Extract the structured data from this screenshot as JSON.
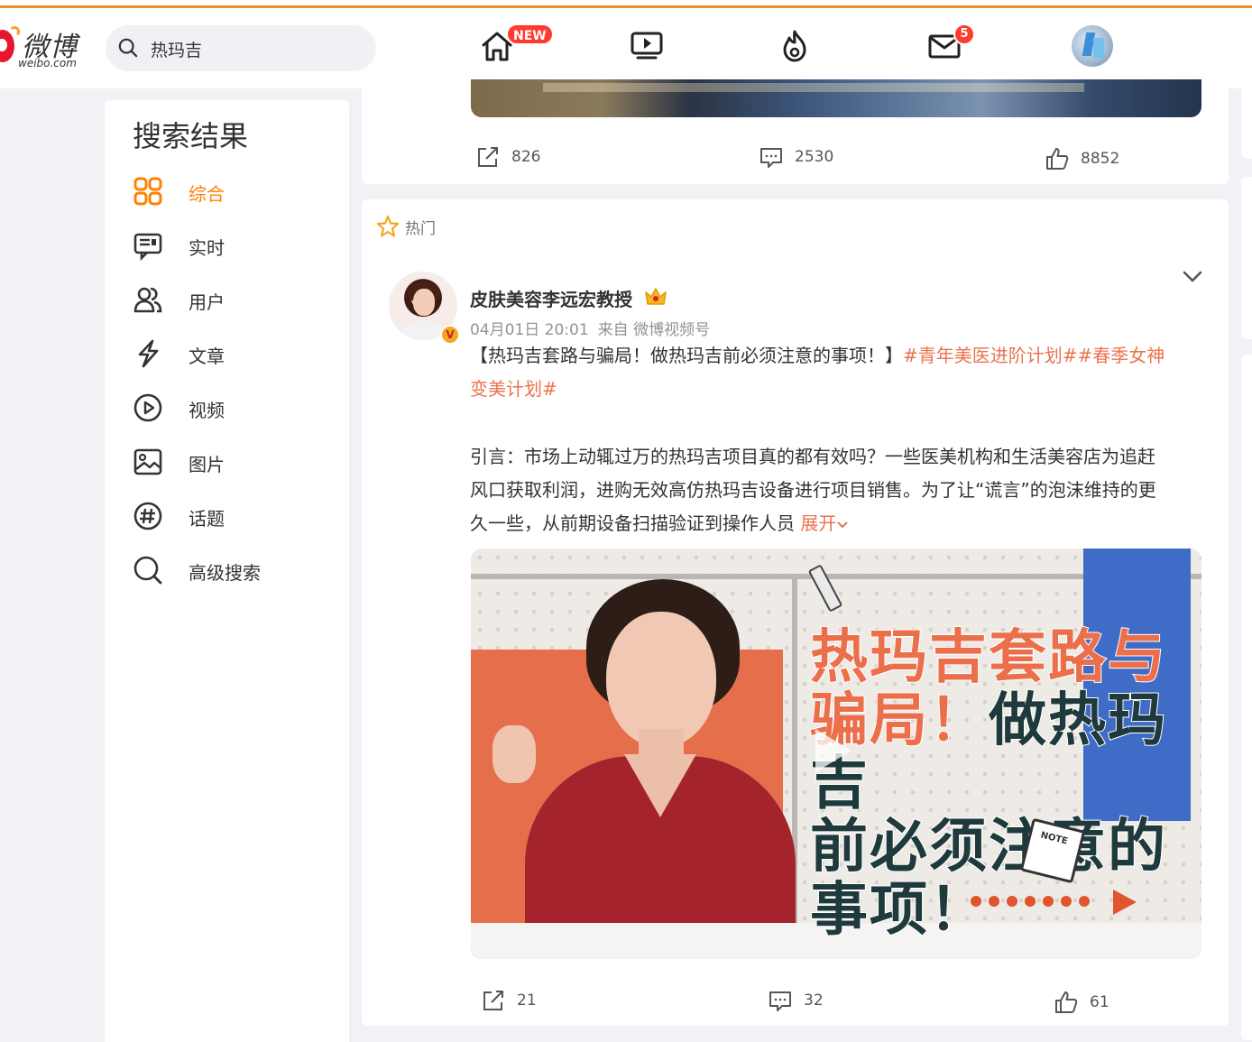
{
  "header": {
    "logo_cn": "微博",
    "logo_en": "weibo.com",
    "search_value": "热玛吉",
    "new_badge": "NEW",
    "message_count": "5"
  },
  "sidebar": {
    "title": "搜索结果",
    "items": [
      {
        "label": "综合",
        "icon": "grid-icon",
        "active": true
      },
      {
        "label": "实时",
        "icon": "feed-icon"
      },
      {
        "label": "用户",
        "icon": "users-icon"
      },
      {
        "label": "文章",
        "icon": "article-icon"
      },
      {
        "label": "视频",
        "icon": "video-play-icon"
      },
      {
        "label": "图片",
        "icon": "image-icon"
      },
      {
        "label": "话题",
        "icon": "hashtag-icon"
      },
      {
        "label": "高级搜索",
        "icon": "search-icon"
      }
    ]
  },
  "post1": {
    "reposts": "826",
    "comments": "2530",
    "likes": "8852"
  },
  "post2": {
    "hot_label": "热门",
    "author": "皮肤美容李远宏教授",
    "time": "04月01日 20:01",
    "source": "来自 微博视频号",
    "verified_mark": "V",
    "text_title": "【热玛吉套路与骗局！做热玛吉前必须注意的事项！】",
    "tag1": "#青年美医进阶计划#",
    "tag2_a": "#春季女神",
    "tag2_b": "变美计划#",
    "para_line1": "引言：市场上动辄过万的热玛吉项目真的都有效吗？一些医美机构和生活美容店为追赶",
    "para_line2": "风口获取利润，进购无效高仿热玛吉设备进行项目销售。为了让“谎言”的泡沫维持的更",
    "para_line3": "久一些，从前期设备扫描验证到操作人员",
    "expand": "展开",
    "video_title_l1": "热玛吉套路与",
    "video_title_l2a": "骗局！",
    "video_title_l2b": "做热玛吉",
    "video_title_l3": "前必须注意的",
    "video_title_l4": "事项！",
    "reposts": "21",
    "comments": "32",
    "likes": "61"
  },
  "colors": {
    "brand_orange": "#ff8200",
    "topic_orange": "#eb7350",
    "badge_red": "#ff3b30"
  }
}
